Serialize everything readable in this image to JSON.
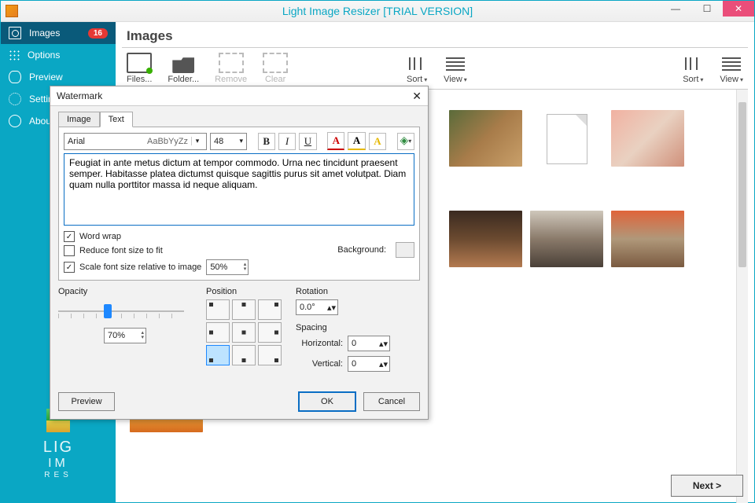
{
  "app": {
    "title": "Light Image Resizer  [TRIAL VERSION]"
  },
  "window_controls": {
    "min": "—",
    "max": "☐",
    "close": "✕"
  },
  "sidebar": {
    "items": [
      {
        "label": "Images",
        "badge": "16"
      },
      {
        "label": "Options"
      },
      {
        "label": "Preview"
      },
      {
        "label": "Settings"
      },
      {
        "label": "About"
      }
    ],
    "logo": {
      "l1": "LIG",
      "l2": "IM",
      "l3": "RES"
    }
  },
  "page": {
    "title": "Images"
  },
  "toolbar": {
    "files": "Files...",
    "folder": "Folder...",
    "remove": "Remove",
    "clear": "Clear",
    "sort": "Sort",
    "view": "View"
  },
  "footer": {
    "next": "Next >"
  },
  "dialog": {
    "title": "Watermark",
    "tabs": {
      "image": "Image",
      "text": "Text"
    },
    "font": {
      "name": "Arial",
      "sample": "AaBbYyZz",
      "size": "48"
    },
    "text_value": "Feugiat in ante metus dictum at tempor commodo. Urna nec tincidunt praesent semper. Habitasse platea dictumst quisque sagittis purus sit amet volutpat. Diam quam nulla porttitor massa id neque aliquam.",
    "options": {
      "word_wrap": "Word wrap",
      "reduce": "Reduce font size to fit",
      "scale": "Scale font size relative to image",
      "scale_value": "50%",
      "background": "Background:"
    },
    "groups": {
      "opacity": "Opacity",
      "opacity_value": "70%",
      "position": "Position",
      "rotation": "Rotation",
      "rotation_value": "0.0°",
      "spacing": "Spacing",
      "horizontal": "Horizontal:",
      "horizontal_value": "0",
      "vertical": "Vertical:",
      "vertical_value": "0"
    },
    "buttons": {
      "preview": "Preview",
      "ok": "OK",
      "cancel": "Cancel"
    }
  }
}
